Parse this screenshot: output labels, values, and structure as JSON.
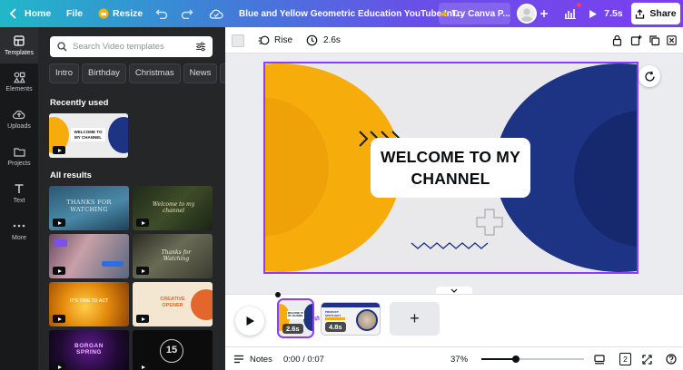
{
  "header": {
    "home_label": "Home",
    "file_label": "File",
    "resize_label": "Resize",
    "title": "Blue and Yellow Geometric Education YouTube Int...",
    "try_canva_label": "Try Canva P...",
    "present_label": "7.5s",
    "share_label": "Share"
  },
  "rail": {
    "items": [
      {
        "label": "Templates",
        "icon": "templates-icon"
      },
      {
        "label": "Elements",
        "icon": "elements-icon"
      },
      {
        "label": "Uploads",
        "icon": "upload-icon"
      },
      {
        "label": "Projects",
        "icon": "folder-icon"
      },
      {
        "label": "Text",
        "icon": "text-icon"
      },
      {
        "label": "More",
        "icon": "more-icon"
      }
    ]
  },
  "panel": {
    "search_placeholder": "Search Video templates",
    "chips": [
      "Intro",
      "Birthday",
      "Christmas",
      "News",
      "R"
    ],
    "recently_used_title": "Recently used",
    "all_results_title": "All results",
    "recent_thumb_text": "WELCOME TO MY CHANNEL",
    "results": [
      "THANKS FOR WATCHING",
      "Welcome to my channel",
      "",
      "Thanks for Watching",
      "IT'S TIME TO ACT",
      "CREATIVE OPENER",
      "BORGAN SPRING",
      "15"
    ]
  },
  "toolbar": {
    "animation_label": "Rise",
    "duration_label": "2.6s"
  },
  "slide": {
    "title_line1": "WELCOME TO MY",
    "title_line2": "CHANNEL",
    "colors": {
      "yellow": "#f6ad0b",
      "navy": "#1d3384",
      "background": "#e9e9eb",
      "accent": "#8b3dff"
    }
  },
  "timeline": {
    "clips": [
      {
        "duration": "2.6s",
        "thumb_text": "WELCOME TO MY CHANNEL"
      },
      {
        "duration": "4.8s",
        "thumb_text": "PRODUCT SPOTLIGHT"
      }
    ],
    "add_label": "+"
  },
  "footer": {
    "notes_label": "Notes",
    "time_label": "0:00 / 0:07",
    "zoom_label": "37%",
    "page_count": "2"
  }
}
